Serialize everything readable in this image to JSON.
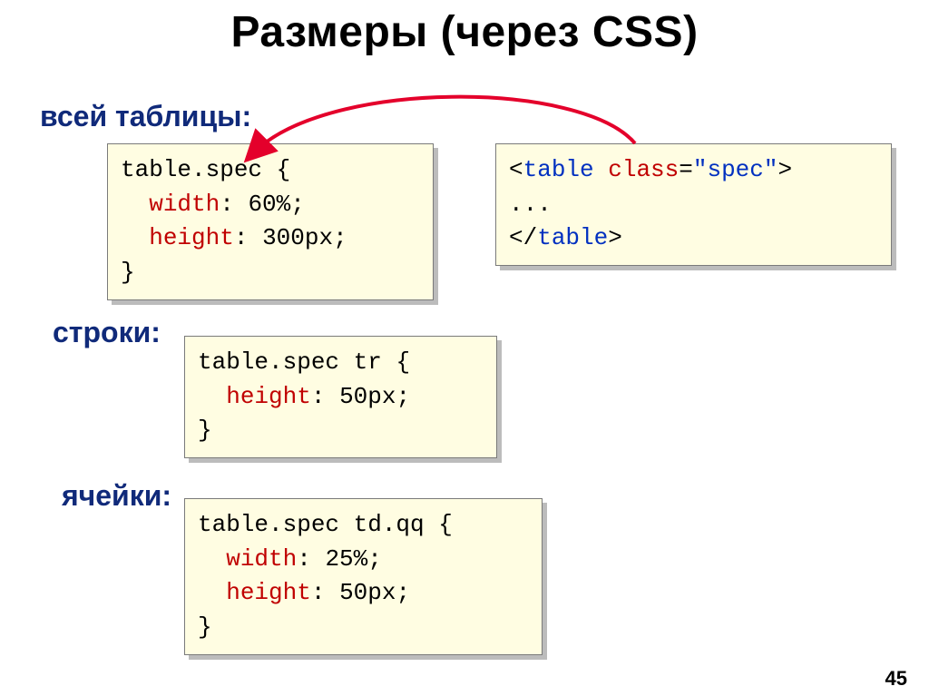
{
  "title": "Размеры (через CSS)",
  "labels": {
    "table": "всей таблицы:",
    "row": "строки:",
    "cell": "ячейки:"
  },
  "code": {
    "tableCss": {
      "selector": "table.spec",
      "open": " {",
      "indent": "  ",
      "props": [
        {
          "name": "width",
          "value": "60%"
        },
        {
          "name": "height",
          "value": "300px"
        }
      ],
      "close": "}"
    },
    "html": {
      "lt": "<",
      "gt": ">",
      "slash": "/",
      "tagOpen": "table ",
      "attrName": "class",
      "eq": "=",
      "attrVal": "\"spec\"",
      "ellipsis": "...",
      "tagClose": "table"
    },
    "rowCss": {
      "selector": "table.spec tr",
      "open": " {",
      "indent": "  ",
      "props": [
        {
          "name": "height",
          "value": "50px"
        }
      ],
      "close": "}"
    },
    "cellCss": {
      "selector": "table.spec td.qq",
      "open": " {",
      "indent": "  ",
      "props": [
        {
          "name": "width",
          "value": "25%"
        },
        {
          "name": "height",
          "value": "50px"
        }
      ],
      "close": "}"
    }
  },
  "pageNumber": "45"
}
